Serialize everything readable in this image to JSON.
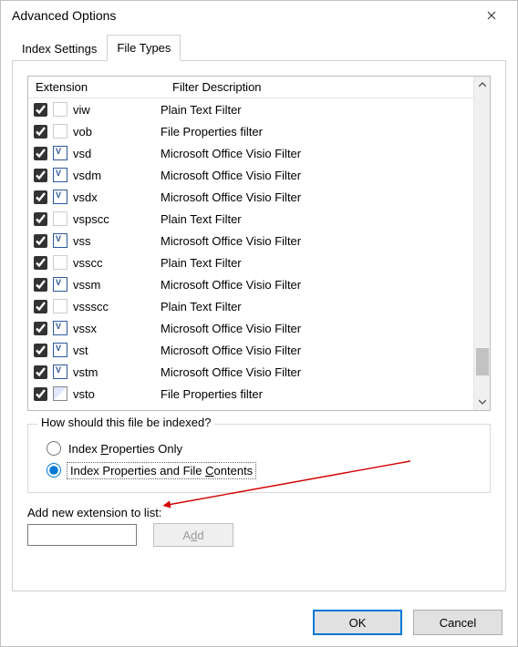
{
  "window": {
    "title": "Advanced Options"
  },
  "tabs": {
    "settings": "Index Settings",
    "filetypes": "File Types"
  },
  "list": {
    "headers": {
      "ext": "Extension",
      "desc": "Filter Description"
    },
    "rows": [
      {
        "checked": true,
        "icon": "plain",
        "ext": "viw",
        "desc": "Plain Text Filter"
      },
      {
        "checked": true,
        "icon": "plain",
        "ext": "vob",
        "desc": "File Properties filter"
      },
      {
        "checked": true,
        "icon": "visio",
        "ext": "vsd",
        "desc": "Microsoft Office Visio Filter"
      },
      {
        "checked": true,
        "icon": "visio",
        "ext": "vsdm",
        "desc": "Microsoft Office Visio Filter"
      },
      {
        "checked": true,
        "icon": "visio",
        "ext": "vsdx",
        "desc": "Microsoft Office Visio Filter"
      },
      {
        "checked": true,
        "icon": "plain",
        "ext": "vspscc",
        "desc": "Plain Text Filter"
      },
      {
        "checked": true,
        "icon": "visio",
        "ext": "vss",
        "desc": "Microsoft Office Visio Filter"
      },
      {
        "checked": true,
        "icon": "plain",
        "ext": "vsscc",
        "desc": "Plain Text Filter"
      },
      {
        "checked": true,
        "icon": "visio",
        "ext": "vssm",
        "desc": "Microsoft Office Visio Filter"
      },
      {
        "checked": true,
        "icon": "plain",
        "ext": "vssscc",
        "desc": "Plain Text Filter"
      },
      {
        "checked": true,
        "icon": "visio",
        "ext": "vssx",
        "desc": "Microsoft Office Visio Filter"
      },
      {
        "checked": true,
        "icon": "visio",
        "ext": "vst",
        "desc": "Microsoft Office Visio Filter"
      },
      {
        "checked": true,
        "icon": "visio",
        "ext": "vstm",
        "desc": "Microsoft Office Visio Filter"
      },
      {
        "checked": true,
        "icon": "vsto",
        "ext": "vsto",
        "desc": "File Properties filter"
      }
    ]
  },
  "group": {
    "legend": "How should this file be indexed?",
    "opt1_pre": "Index ",
    "opt1_u": "P",
    "opt1_post": "roperties Only",
    "opt2_pre": "Index Properties and File ",
    "opt2_u": "C",
    "opt2_post": "ontents",
    "selected": "contents"
  },
  "add": {
    "label": "Add new extension to list:",
    "value": "",
    "button_pre": "A",
    "button_u": "d",
    "button_post": "d"
  },
  "footer": {
    "ok": "OK",
    "cancel": "Cancel"
  }
}
